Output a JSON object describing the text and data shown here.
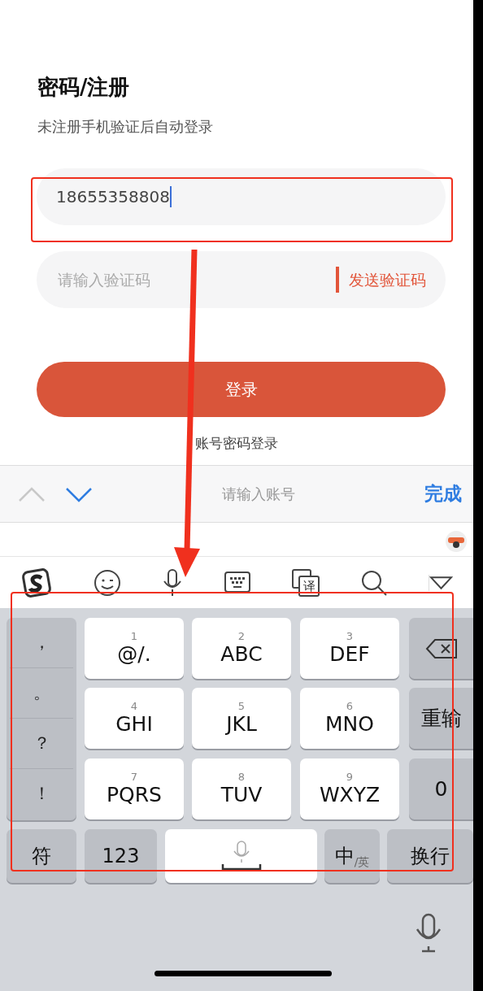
{
  "title": "密码/注册",
  "subtitle": "未注册手机验证后自动登录",
  "phone_field": {
    "value": "18655358808",
    "focused": true
  },
  "code_field": {
    "placeholder": "请输入验证码",
    "send_button": "发送验证码"
  },
  "login_button": "登录",
  "alt_login_link": "账号密码登录",
  "input_toolbar": {
    "arrows": [
      {
        "kind": "up",
        "disabled": true
      },
      {
        "kind": "down",
        "disabled": false
      }
    ],
    "hint": "请输入账号",
    "done_button": "完成"
  },
  "ime_toolbar": [
    {
      "kind": "logo"
    },
    {
      "kind": "emoji"
    },
    {
      "kind": "mic"
    },
    {
      "kind": "keyboard"
    },
    {
      "kind": "translate",
      "label": "译"
    },
    {
      "kind": "search"
    },
    {
      "kind": "collapse"
    }
  ],
  "keyboard": {
    "punctuation": [
      "，",
      "。",
      "？",
      "！"
    ],
    "keys": [
      {
        "digit": "1",
        "letters": "@/."
      },
      {
        "digit": "2",
        "letters": "ABC"
      },
      {
        "digit": "3",
        "letters": "DEF"
      },
      {
        "digit": "4",
        "letters": "GHI"
      },
      {
        "digit": "5",
        "letters": "JKL"
      },
      {
        "digit": "6",
        "letters": "MNO"
      },
      {
        "digit": "7",
        "letters": "PQRS"
      },
      {
        "digit": "8",
        "letters": "TUV"
      },
      {
        "digit": "9",
        "letters": "WXYZ"
      }
    ],
    "side_keys": [
      {
        "kind": "backspace"
      },
      {
        "kind": "text",
        "label": "重输"
      },
      {
        "kind": "text",
        "label": "0"
      }
    ],
    "bottom_row": [
      {
        "kind": "text",
        "label": "符"
      },
      {
        "kind": "text",
        "label": "123"
      },
      {
        "kind": "space"
      },
      {
        "kind": "lang",
        "main": "中",
        "sub": "/英"
      },
      {
        "kind": "text",
        "label": "换行"
      }
    ]
  }
}
